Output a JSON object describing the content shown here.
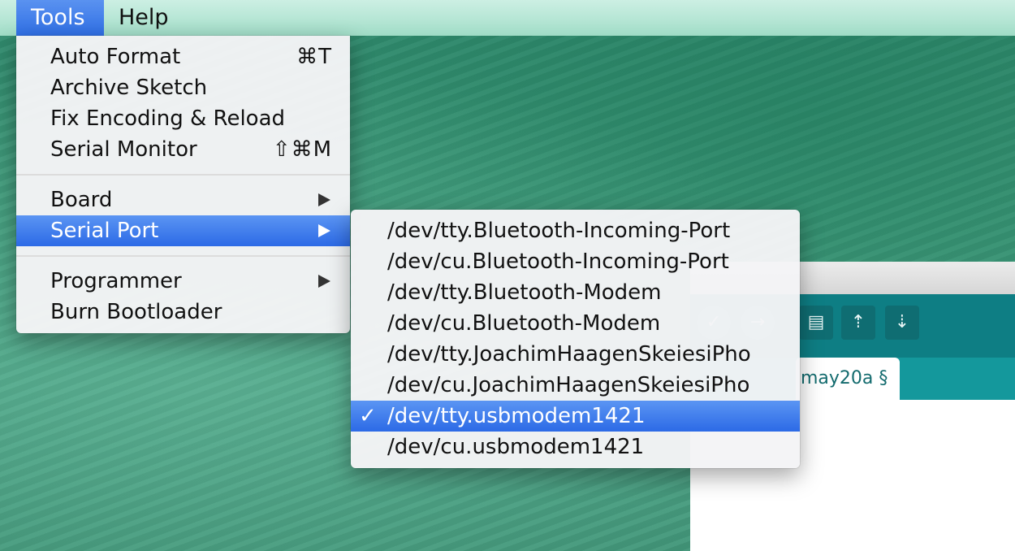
{
  "menubar": {
    "items": [
      {
        "label": "Tools",
        "active": true
      },
      {
        "label": "Help",
        "active": false
      }
    ]
  },
  "tools_menu": {
    "items": [
      {
        "label": "Auto Format",
        "shortcut": "⌘T"
      },
      {
        "label": "Archive Sketch"
      },
      {
        "label": "Fix Encoding & Reload"
      },
      {
        "label": "Serial Monitor",
        "shortcut": "⇧⌘M"
      },
      {
        "label": "Board",
        "submenu": true
      },
      {
        "label": "Serial Port",
        "submenu": true,
        "highlighted": true
      },
      {
        "label": "Programmer",
        "submenu": true
      },
      {
        "label": "Burn Bootloader"
      }
    ]
  },
  "serial_port_menu": {
    "items": [
      {
        "label": "/dev/tty.Bluetooth-Incoming-Port"
      },
      {
        "label": "/dev/cu.Bluetooth-Incoming-Port"
      },
      {
        "label": "/dev/tty.Bluetooth-Modem"
      },
      {
        "label": "/dev/cu.Bluetooth-Modem"
      },
      {
        "label": "/dev/tty.JoachimHaagenSkeiesiPho"
      },
      {
        "label": "/dev/cu.JoachimHaagenSkeiesiPho"
      },
      {
        "label": "/dev/tty.usbmodem1421",
        "checked": true,
        "highlighted": true,
        "check_mark": "✓"
      },
      {
        "label": "/dev/cu.usbmodem1421"
      }
    ]
  },
  "ide": {
    "tab_label": "may20a §",
    "toolbar_icons": [
      "verify-icon",
      "upload-icon",
      "new-icon",
      "open-icon",
      "save-icon"
    ]
  },
  "colors": {
    "highlight": "#2f6fe5",
    "toolbar": "#0e7e84",
    "tabstrip": "#14989c"
  }
}
